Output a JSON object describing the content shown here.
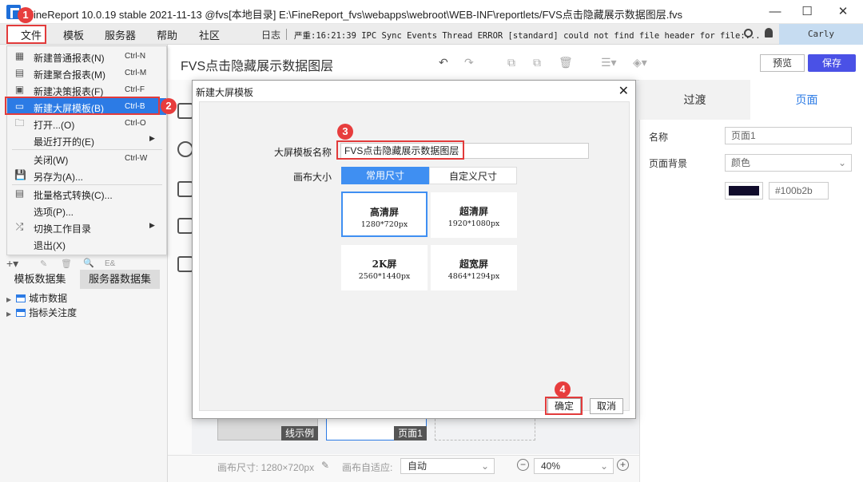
{
  "titlebar": {
    "title": "FineReport 10.0.19 stable 2021-11-13 @fvs[本地目录]    E:\\FineReport_fvs\\webapps\\webroot\\WEB-INF\\reportlets/FVS点击隐藏展示数据图层.fvs",
    "minimize": "—",
    "maximize": "☐",
    "close": "✕"
  },
  "menubar": {
    "items": [
      "文件",
      "模板",
      "服务器",
      "帮助",
      "社区"
    ],
    "log_label": "日志",
    "log_text": "严重:16:21:39 IPC Sync Events Thread ERROR [standard] could not find file header for file:...",
    "user": "Carly"
  },
  "file_menu": {
    "items": [
      {
        "label": "新建普通报表(N)",
        "shortcut": "Ctrl-N",
        "icon": "grid-icon"
      },
      {
        "label": "新建聚合报表(M)",
        "shortcut": "Ctrl-M",
        "icon": "aggregate-report-icon"
      },
      {
        "label": "新建决策报表(F)",
        "shortcut": "Ctrl-F",
        "icon": "form-icon"
      },
      {
        "label": "新建大屏模板(B)",
        "shortcut": "Ctrl-B",
        "icon": "dashboard-icon"
      },
      {
        "label": "打开...(O)",
        "shortcut": "Ctrl-O",
        "icon": "folder-icon"
      },
      {
        "label": "最近打开的(E)",
        "shortcut": "",
        "icon": ""
      },
      {
        "label": "关闭(W)",
        "shortcut": "Ctrl-W",
        "icon": ""
      },
      {
        "label": "另存为(A)...",
        "shortcut": "",
        "icon": "save-icon"
      },
      {
        "label": "批量格式转换(C)...",
        "shortcut": "",
        "icon": "convert-icon"
      },
      {
        "label": "选项(P)...",
        "shortcut": "",
        "icon": ""
      },
      {
        "label": "切换工作目录",
        "shortcut": "",
        "icon": "switch-icon"
      },
      {
        "label": "退出(X)",
        "shortcut": "",
        "icon": ""
      }
    ]
  },
  "badges": [
    "1",
    "2",
    "3",
    "4"
  ],
  "left_panel": {
    "tabs": [
      "模板数据集",
      "服务器数据集"
    ],
    "tree": [
      "城市数据",
      "指标关注度"
    ]
  },
  "document": {
    "title": "FVS点击隐藏展示数据图层",
    "preview": "预览",
    "save": "保存"
  },
  "right_panel": {
    "tabs": [
      "过渡",
      "页面"
    ],
    "name_label": "名称",
    "name_value": "页面1",
    "bg_label": "页面背景",
    "bg_value": "颜色",
    "color_hex": "#100b2b"
  },
  "dialog": {
    "title": "新建大屏模板",
    "name_label": "大屏模板名称",
    "name_value": "FVS点击隐藏展示数据图层",
    "size_label": "画布大小",
    "size_tabs": [
      "常用尺寸",
      "自定义尺寸"
    ],
    "presets": [
      {
        "name": "高清屏",
        "dim": "1280*720px"
      },
      {
        "name": "超清屏",
        "dim": "1920*1080px"
      },
      {
        "name": "2K屏",
        "dim": "2560*1440px"
      },
      {
        "name": "超宽屏",
        "dim": "4864*1294px"
      }
    ],
    "ok": "确定",
    "cancel": "取消"
  },
  "pages": [
    "线示例",
    "页面1"
  ],
  "bottom": {
    "canvas_size": "画布尺寸: 1280×720px",
    "adapt_label": "画布自适应:",
    "adapt_value": "自动",
    "zoom": "40%"
  },
  "colors": {
    "accent": "#2c7be5",
    "save_btn": "#4a51e6",
    "badge": "#e73d3d",
    "swatch": "#100b2b"
  }
}
